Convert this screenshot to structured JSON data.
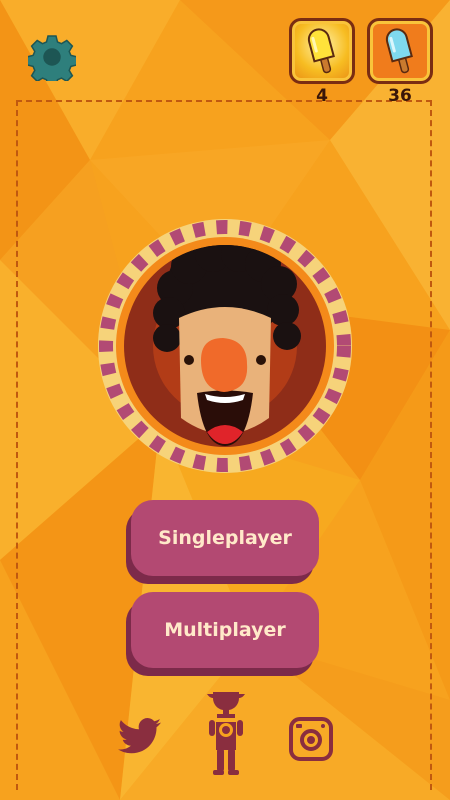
{
  "top_bar": {
    "settings_icon": "gear-icon",
    "yellow_popsicle": {
      "icon": "yellow-popsicle-icon",
      "count": "4"
    },
    "blue_popsicle": {
      "icon": "blue-popsicle-icon",
      "count": "36"
    }
  },
  "avatar": {
    "icon": "curly-hair-laughing-face"
  },
  "menu": {
    "singleplayer_label": "Singleplayer",
    "multiplayer_label": "Multiplayer"
  },
  "bottom_bar": {
    "twitter_icon": "twitter-bird-icon",
    "leaderboard_icon": "trophy-figure-icon",
    "instagram_icon": "instagram-camera-icon"
  },
  "colors": {
    "background": "#f7a21e",
    "button": "#b34972",
    "button_shadow": "#7c2a4a",
    "button_text": "#ffe9c9",
    "icon_dark": "#8a2e3f",
    "gear": "#2e7f7c"
  }
}
